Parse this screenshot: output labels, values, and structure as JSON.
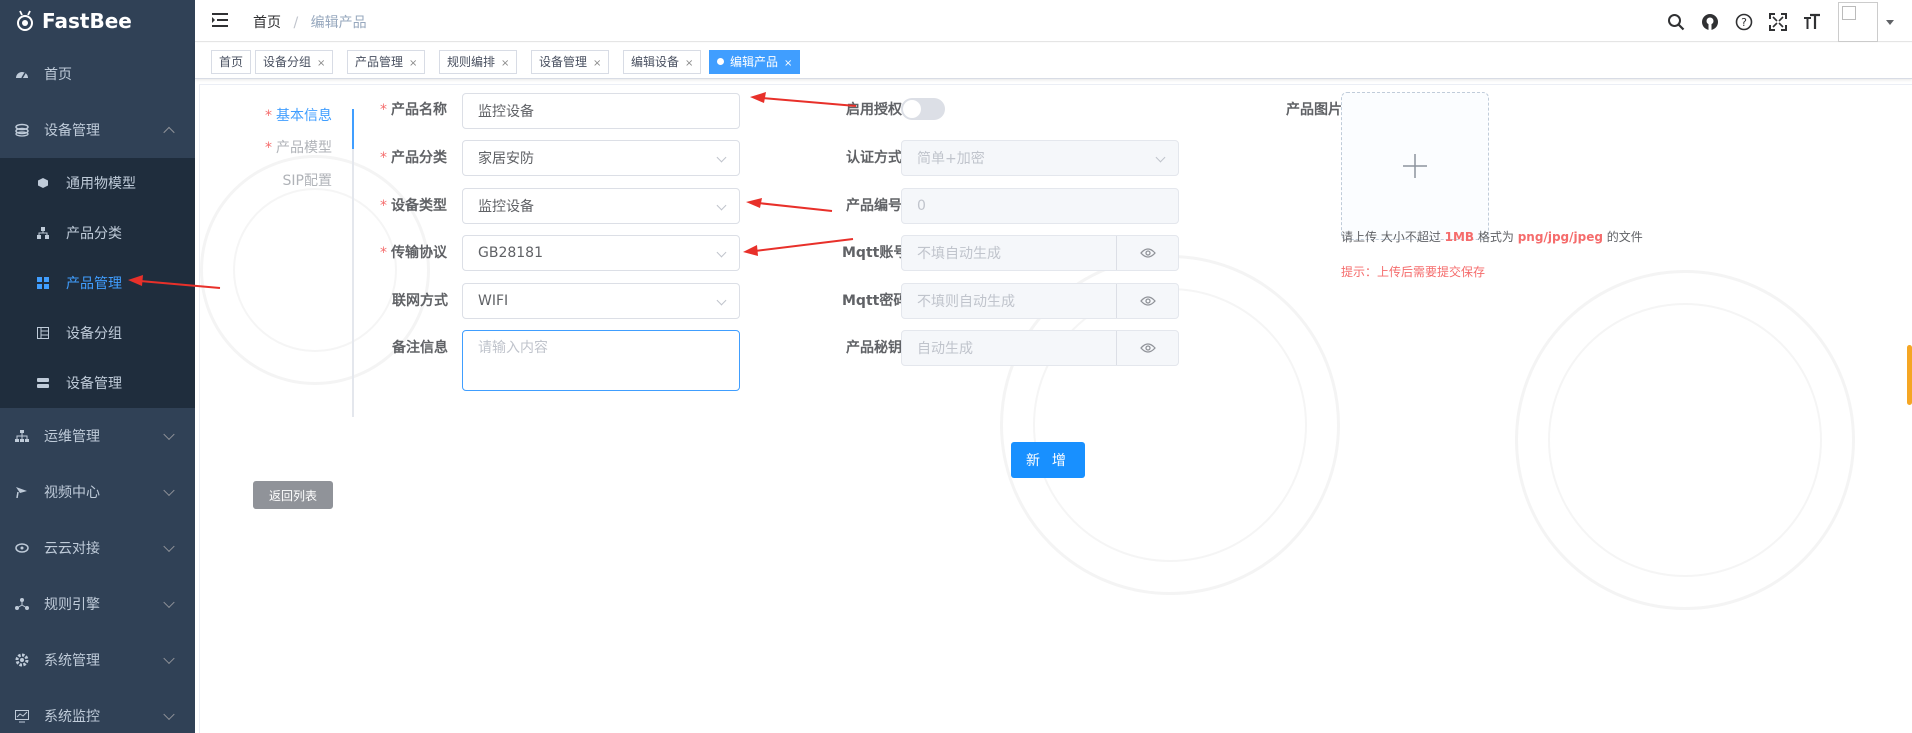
{
  "app": {
    "name": "FastBee"
  },
  "sidebar": {
    "items": [
      {
        "label": "首页",
        "icon": "dashboard-icon"
      },
      {
        "label": "设备管理",
        "icon": "device-icon",
        "expanded": true
      },
      {
        "label": "运维管理",
        "icon": "ops-icon"
      },
      {
        "label": "视频中心",
        "icon": "video-icon"
      },
      {
        "label": "云云对接",
        "icon": "cloud-icon"
      },
      {
        "label": "规则引擎",
        "icon": "rule-icon"
      },
      {
        "label": "系统管理",
        "icon": "gear-icon"
      },
      {
        "label": "系统监控",
        "icon": "monitor-icon"
      }
    ],
    "submenu": [
      {
        "label": "通用物模型",
        "icon": "cube-icon"
      },
      {
        "label": "产品分类",
        "icon": "tree-icon"
      },
      {
        "label": "产品管理",
        "icon": "grid-icon",
        "active": true
      },
      {
        "label": "设备分组",
        "icon": "group-icon"
      },
      {
        "label": "设备管理",
        "icon": "server-icon"
      }
    ]
  },
  "navbar": {
    "breadcrumb": [
      "首页",
      "编辑产品"
    ],
    "icons": [
      "search-icon",
      "github-icon",
      "help-icon",
      "fullscreen-icon",
      "font-size-icon"
    ]
  },
  "tags": [
    {
      "label": "首页"
    },
    {
      "label": "设备分组"
    },
    {
      "label": "产品管理"
    },
    {
      "label": "规则编排"
    },
    {
      "label": "设备管理"
    },
    {
      "label": "编辑设备"
    },
    {
      "label": "编辑产品",
      "active": true
    }
  ],
  "vtabs": [
    {
      "label": "基本信息",
      "required": true,
      "active": true
    },
    {
      "label": "产品模型",
      "required": true
    },
    {
      "label": "SIP配置",
      "required": false
    }
  ],
  "back_button": "返回列表",
  "form": {
    "product_name": {
      "label": "产品名称",
      "value": "监控设备"
    },
    "product_category": {
      "label": "产品分类",
      "value": "家居安防"
    },
    "device_type": {
      "label": "设备类型",
      "value": "监控设备"
    },
    "protocol": {
      "label": "传输协议",
      "value": "GB28181"
    },
    "network": {
      "label": "联网方式",
      "value": "WIFI"
    },
    "remark": {
      "label": "备注信息",
      "placeholder": "请输入内容"
    },
    "auth_enabled": {
      "label": "启用授权",
      "value": false
    },
    "auth_method": {
      "label": "认证方式",
      "value": "简单+加密"
    },
    "product_id": {
      "label": "产品编号",
      "value": "0"
    },
    "mqtt_account": {
      "label": "Mqtt账号",
      "placeholder": "不填自动生成"
    },
    "mqtt_password": {
      "label": "Mqtt密码",
      "placeholder": "不填则自动生成"
    },
    "product_secret": {
      "label": "产品秘钥",
      "placeholder": "自动生成"
    },
    "product_image": {
      "label": "产品图片"
    }
  },
  "upload": {
    "tip_prefix": "请上传 大小不超过 ",
    "tip_size": "1MB",
    "tip_mid": " 格式为 ",
    "tip_formats": "png/jpg/jpeg",
    "tip_suffix": " 的文件",
    "warning": "提示：上传后需要提交保存"
  },
  "submit_button": "新 增",
  "colors": {
    "sidebar_bg": "#304156",
    "submenu_bg": "#1f2d3d",
    "primary": "#409eff",
    "danger": "#f56c6c",
    "annotation_arrow": "#e8302a"
  }
}
